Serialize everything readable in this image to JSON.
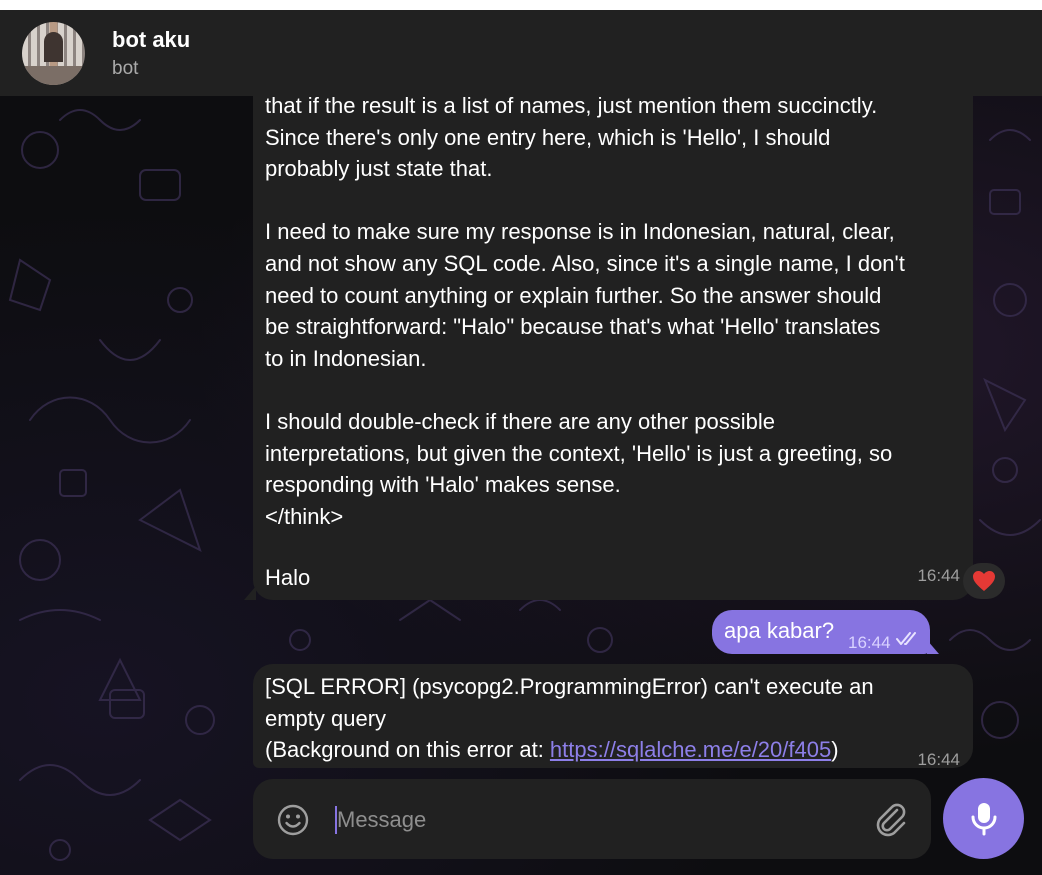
{
  "header": {
    "title": "bot aku",
    "subtitle": "bot"
  },
  "messages": [
    {
      "from": "bot",
      "paragraphs": [
        "that if the result is a list of names, just mention them succinctly.\nSince there's only one entry here, which is 'Hello', I should\nprobably just state that.",
        "I need to make sure my response is in Indonesian, natural, clear,\nand not show any SQL code. Also, since it's a single name, I don't\nneed to count anything or explain further. So the answer should\nbe straightforward: \"Halo\" because that's what 'Hello' translates\nto in Indonesian.",
        "I should double-check if there are any other possible\ninterpretations, but given the context, 'Hello' is just a greeting, so\nresponding with 'Halo' makes sense.\n</think>"
      ],
      "final_text": "Halo",
      "time": "16:44",
      "reaction": "heart"
    },
    {
      "from": "me",
      "text": "apa kabar?",
      "time": "16:44",
      "status": "read"
    },
    {
      "from": "bot",
      "text_line1": "[SQL ERROR] (psycopg2.ProgrammingError) can't execute an",
      "text_line2": "empty query",
      "text_prefix": "(Background on this error at: ",
      "link": "https://sqlalche.me/e/20/f405",
      "text_suffix": ")",
      "time": "16:44"
    }
  ],
  "composer": {
    "placeholder": "Message"
  },
  "colors": {
    "accent": "#8774e1",
    "bubble": "#212121",
    "header": "#212121",
    "reaction": "#e53935"
  },
  "icons": [
    "emoji-icon",
    "attach-icon",
    "mic-icon",
    "read-checks-icon",
    "heart-icon"
  ]
}
